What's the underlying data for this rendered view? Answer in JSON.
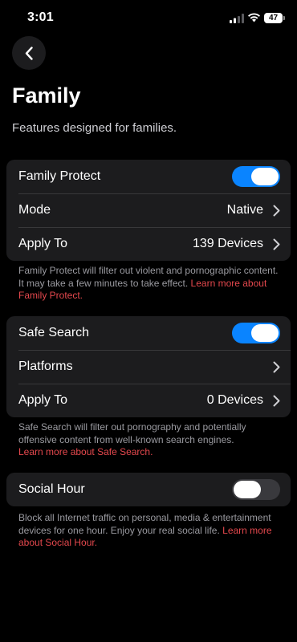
{
  "status_bar": {
    "time": "3:01",
    "battery": "47"
  },
  "header": {
    "title": "Family",
    "subtitle": "Features designed for families."
  },
  "family_protect": {
    "label": "Family Protect",
    "enabled": true,
    "mode_label": "Mode",
    "mode_value": "Native",
    "apply_label": "Apply To",
    "apply_value": "139 Devices",
    "note": "Family Protect will filter out violent and pornographic content. It may take a few minutes to take effect. ",
    "link": "Learn more about Family Protect."
  },
  "safe_search": {
    "label": "Safe Search",
    "enabled": true,
    "platforms_label": "Platforms",
    "apply_label": "Apply To",
    "apply_value": "0 Devices",
    "note": "Safe Search will filter out pornography and potentially offensive content from well-known search engines.",
    "link": "Learn more about Safe Search."
  },
  "social_hour": {
    "label": "Social Hour",
    "enabled": false,
    "note": "Block all Internet traffic on personal, media & entertainment devices for one hour. Enjoy your real social life. ",
    "link": "Learn more about Social Hour."
  },
  "colors": {
    "accent": "#0a84ff",
    "link": "#e5484d",
    "card": "#1c1c1e",
    "background": "#000000"
  }
}
